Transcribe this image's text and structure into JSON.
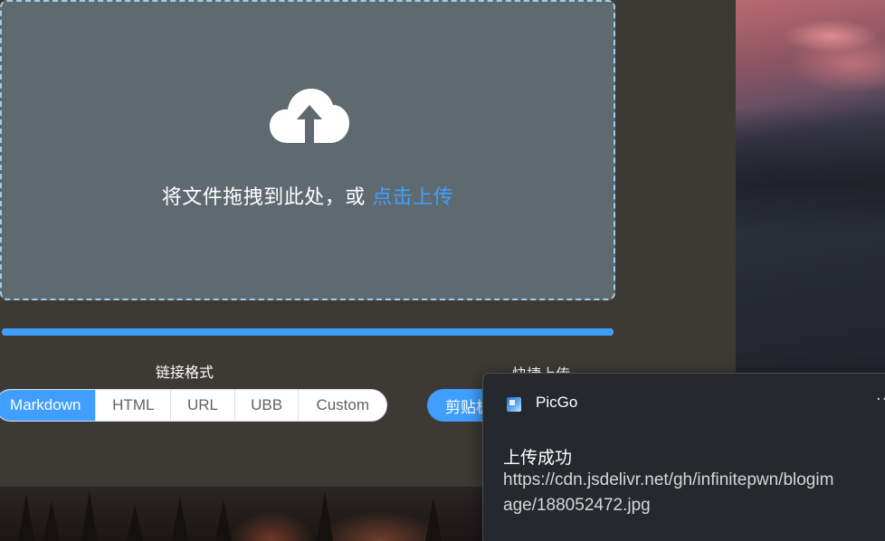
{
  "drop_zone": {
    "text_prefix": "将文件拖拽到此处，或 ",
    "text_link": "点击上传",
    "icon": "upload-cloud-icon"
  },
  "progress": {
    "percent": 100,
    "color": "#409eff"
  },
  "link_format": {
    "label": "链接格式",
    "options": [
      "Markdown",
      "HTML",
      "URL",
      "UBB",
      "Custom"
    ],
    "selected": "Markdown"
  },
  "quick_upload": {
    "label": "快捷上传",
    "button_label": "剪贴板图片"
  },
  "toast": {
    "app_icon": "picgo-app-icon",
    "app_name": "PicGo",
    "more_icon": "more-icon",
    "title": "上传成功",
    "body": "https://cdn.jsdelivr.net/gh/infinitepwn/blogimage/188052472.jpg"
  },
  "colors": {
    "accent": "#409eff",
    "drop_zone_bg": "#5f6a70",
    "window_bg": "#3d3935",
    "toast_bg": "#25292e"
  }
}
